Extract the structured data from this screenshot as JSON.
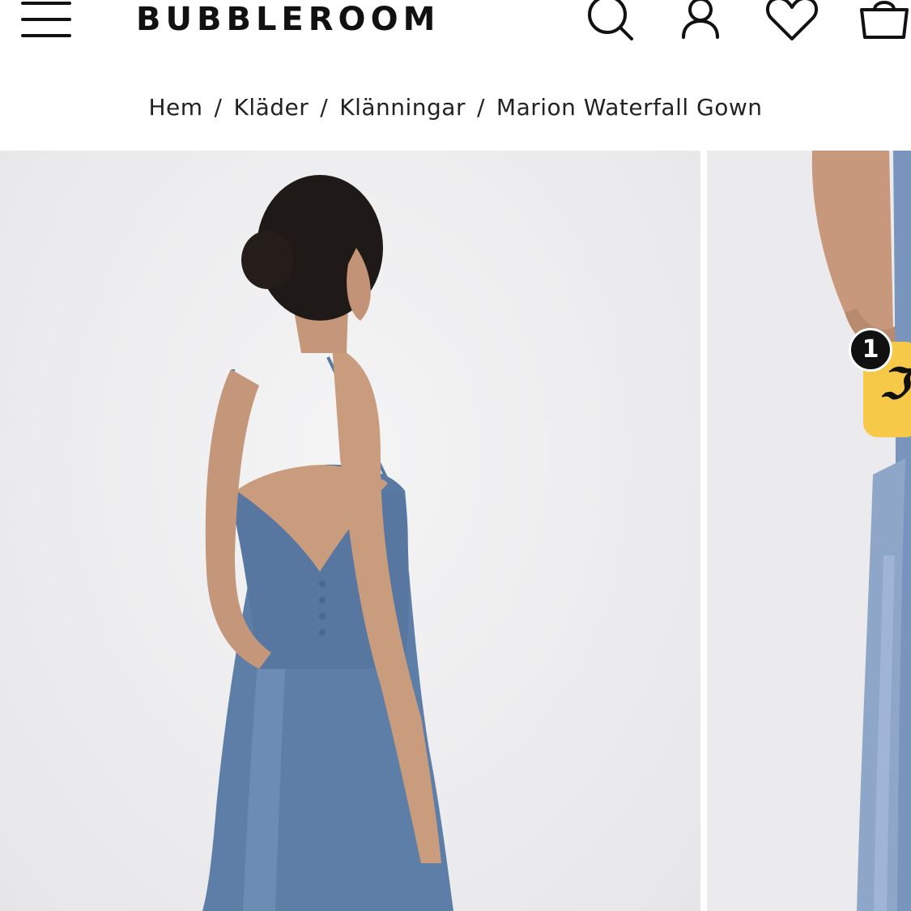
{
  "header": {
    "logo": "BUBBLEROOM",
    "menu_icon": "hamburger-menu-icon",
    "icons": [
      "search-icon",
      "account-icon",
      "wishlist-heart-icon",
      "cart-bag-icon"
    ]
  },
  "breadcrumb": {
    "items": [
      "Hem",
      "Kläder",
      "Klänningar",
      "Marion Waterfall Gown"
    ],
    "separator": "/"
  },
  "gallery": {
    "main_image": "product-photo-model-back-view",
    "next_image": "product-photo-model-side-view"
  },
  "floating_widget": {
    "count": "1",
    "icon": "chat-widget-icon",
    "color": "#f7c948"
  },
  "colors": {
    "dress": "#5d7ea6",
    "background": "#ececee"
  }
}
